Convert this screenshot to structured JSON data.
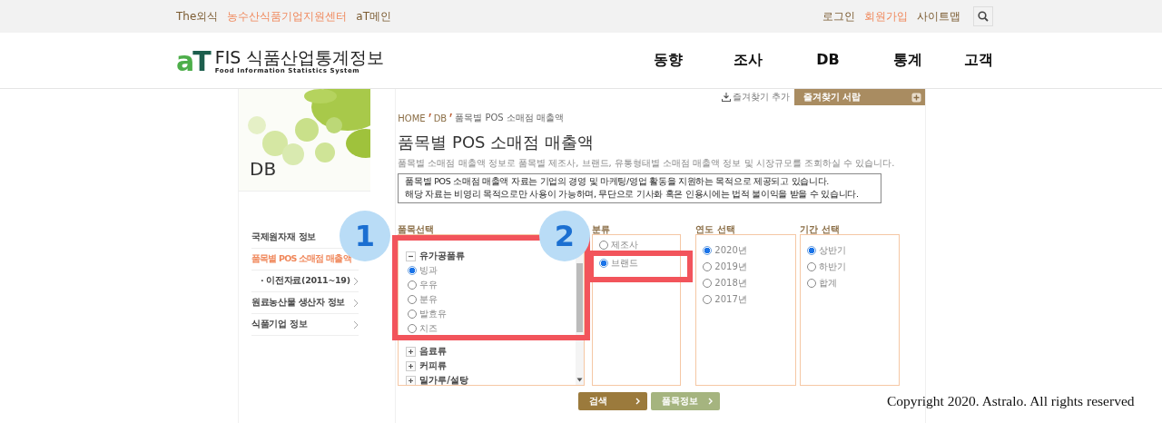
{
  "top_bar": {
    "left_links": [
      {
        "label": "The외식",
        "highlighted": false
      },
      {
        "label": "농수산식품기업지원센터",
        "highlighted": true
      },
      {
        "label": "aT메인",
        "highlighted": false
      }
    ],
    "right_links": [
      {
        "label": "로그인",
        "highlighted": false
      },
      {
        "label": "회원가입",
        "highlighted": true
      },
      {
        "label": "사이트맵",
        "highlighted": false
      }
    ]
  },
  "logo": {
    "mark_a": "a",
    "mark_t": "T",
    "title": "FIS 식품산업통계정보",
    "subtitle": "Food Information Statistics System"
  },
  "nav": [
    {
      "label": "동향"
    },
    {
      "label": "조사"
    },
    {
      "label": "DB"
    },
    {
      "label": "통계"
    },
    {
      "label": "고객"
    }
  ],
  "sidebar": {
    "banner_title": "DB",
    "items": [
      {
        "label": "국제원자재 정보",
        "selected": false,
        "sub": false,
        "arrow": false
      },
      {
        "label": "품목별 POS 소매점 매출액",
        "selected": true,
        "sub": false,
        "arrow": false
      },
      {
        "label": "· 이전자료(2011~19)",
        "selected": false,
        "sub": true,
        "arrow": true
      },
      {
        "label": "원료농산물 생산자 정보",
        "selected": false,
        "sub": false,
        "arrow": true
      },
      {
        "label": "식품기업 정보",
        "selected": false,
        "sub": false,
        "arrow": true
      }
    ]
  },
  "favorites": {
    "add": "즐겨찾기 추가",
    "drawer": "즐겨찾기 서랍"
  },
  "breadcrumb": [
    "HOME",
    "DB",
    "품목별 POS 소매점 매출액"
  ],
  "title": "품목별 POS 소매점 매출액",
  "description": "품목별 소매점 매출액 정보로 품목별 제조사, 브랜드, 유통형태별 소매점 매출액 정보 및 시장규모를 조회하실 수 있습니다.",
  "notice": [
    "품목별 POS 소매점 매출액 자료는 기업의 경영 및 마케팅/영업 활동을 지원하는 목적으로 제공되고 있습니다.",
    "해당 자료는 비영리 목적으로만 사용이 가능하며, 무단으로 기사화 혹은 인용시에는 법적 불이익을 받을 수 있습니다."
  ],
  "item_select": {
    "heading": "품목선택",
    "tree": [
      {
        "label": "유가공품류",
        "expanded": true,
        "children": [
          {
            "label": "빙과",
            "selected": true
          },
          {
            "label": "우유",
            "selected": false
          },
          {
            "label": "분유",
            "selected": false
          },
          {
            "label": "발효유",
            "selected": false
          },
          {
            "label": "치즈",
            "selected": false
          }
        ]
      },
      {
        "label": "음료류",
        "expanded": false
      },
      {
        "label": "커피류",
        "expanded": false
      },
      {
        "label": "밀가루/설탕",
        "expanded": false
      }
    ]
  },
  "option_groups": [
    {
      "heading": "분류",
      "options": [
        {
          "label": "제조사",
          "selected": false
        },
        {
          "label": "브랜드",
          "selected": true
        }
      ]
    },
    {
      "heading": "연도 선택",
      "options": [
        {
          "label": "2020년",
          "selected": true
        },
        {
          "label": "2019년",
          "selected": false
        },
        {
          "label": "2018년",
          "selected": false
        },
        {
          "label": "2017년",
          "selected": false
        }
      ]
    },
    {
      "heading": "기간 선택",
      "options": [
        {
          "label": "상반기",
          "selected": true
        },
        {
          "label": "하반기",
          "selected": false
        },
        {
          "label": "합계",
          "selected": false
        }
      ]
    }
  ],
  "buttons": [
    {
      "label": "검색",
      "kind": "primary"
    },
    {
      "label": "품목정보",
      "kind": "secondary"
    }
  ],
  "annotations": [
    {
      "number": "1"
    },
    {
      "number": "2"
    }
  ],
  "copyright": "Copyright 2020. Astralo. All rights reserved"
}
